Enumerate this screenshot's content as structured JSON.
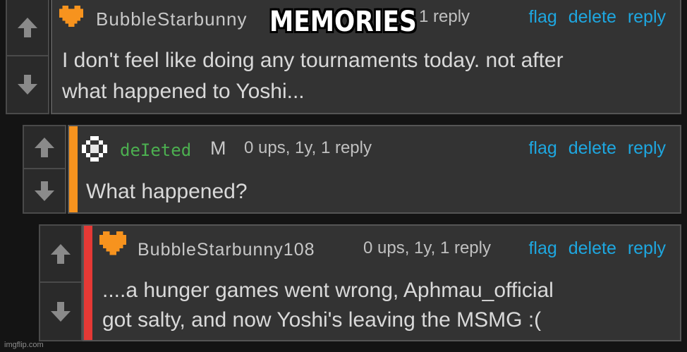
{
  "caption": "MEMORIES",
  "watermark": "imgflip.com",
  "colors": {
    "link": "#1ea7e0",
    "deleted_user": "#4caf50",
    "stripe_reply1": "#f7931e",
    "stripe_reply2": "#e53935",
    "heart": "#f7931e"
  },
  "comments": [
    {
      "username": "BubbleStarbunny",
      "meta": "1 reply",
      "actions": [
        "flag",
        "delete",
        "reply"
      ],
      "lines": [
        "I don't feel like doing any tournaments today. not after",
        "what happened to Yoshi..."
      ],
      "avatar_icon": "heart-pixel-icon"
    },
    {
      "username": "deIeted",
      "mod_badge": "M",
      "meta": "0 ups, 1y, 1 reply",
      "actions": [
        "flag",
        "delete",
        "reply"
      ],
      "lines": [
        "What happened?"
      ],
      "avatar_icon": "checker-pixel-icon"
    },
    {
      "username": "BubbleStarbunny108",
      "meta": "0 ups, 1y, 1 reply",
      "actions": [
        "flag",
        "delete",
        "reply"
      ],
      "lines": [
        "....a hunger games went wrong, Aphmau_official",
        "got salty, and now Yoshi's leaving the MSMG :("
      ],
      "avatar_icon": "heart-pixel-icon"
    }
  ]
}
